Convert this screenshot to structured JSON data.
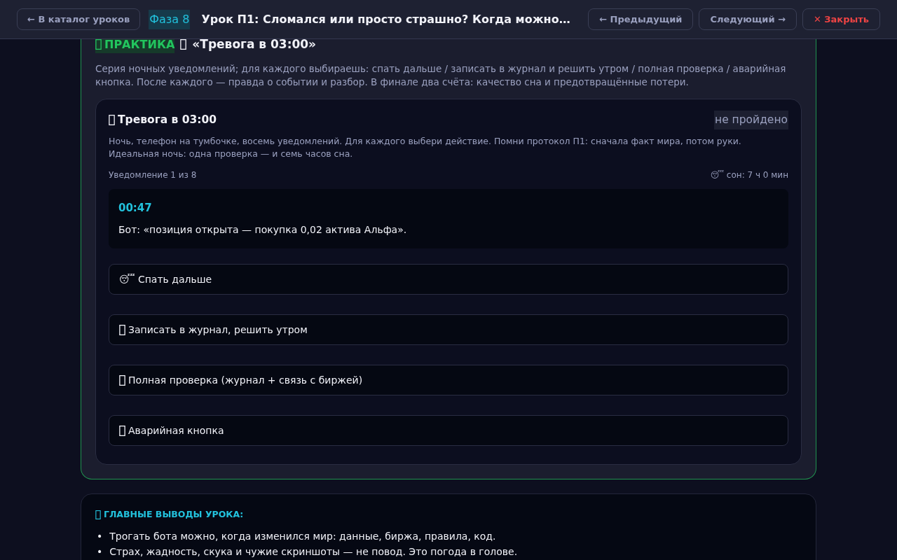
{
  "header": {
    "back_link": "← В каталог уроков",
    "phase": "Фаза 8",
    "title": "Урок П1: Сломался или просто страшно? Когда можно…",
    "buttons": [
      {
        "kind": "nav",
        "label": "← Предыдущий"
      },
      {
        "kind": "nav",
        "label": "Следующий →"
      },
      {
        "kind": "close",
        "label": "✕ Закрыть"
      }
    ]
  },
  "practice": {
    "badge": "ПРАКТИКА",
    "title": "«Тревога в 03:00»",
    "description": "Серия ночных уведомлений; для каждого выбираешь: спать дальше / записать в журнал и решить утром / полная проверка / аварийная кнопка. После каждого — правда о событии и разбор. В финале два счёта: качество сна и предотвращённые потери.",
    "game": {
      "title": "Тревога в 03:00",
      "status": "не пройдено",
      "intro": "Ночь, телефон на тумбочке, восемь уведомлений. Для каждого выбери действие. Помни протокол П1: сначала факт мира, потом руки. Идеальная ночь: одна проверка — и семь часов сна.",
      "progress": "Уведомление 1 из 8",
      "sleep": "😴 сон: 7 ч 0 мин",
      "notification": {
        "time": "00:47",
        "text": "Бот: «позиция открыта — покупка 0,02 актива Альфа»."
      },
      "choices": [
        {
          "label": "😴 Спать дальше",
          "glyph_box": false
        },
        {
          "label": "Записать в журнал, решить утром",
          "glyph_box": true
        },
        {
          "label": "Полная проверка (журнал + связь с биржей)",
          "glyph_box": true
        },
        {
          "label": "Аварийная кнопка",
          "glyph_box": true
        }
      ]
    }
  },
  "takeaways": {
    "title": "ГЛАВНЫЕ ВЫВОДЫ УРОКА:",
    "items": [
      {
        "bullet": "•",
        "text": "Трогать бота можно, когда изменился мир: данные, биржа, правила, код."
      },
      {
        "bullet": "•",
        "text": "Страх, жадность, скука и чужие скриншоты — не повод. Это погода в голове."
      }
    ]
  }
}
